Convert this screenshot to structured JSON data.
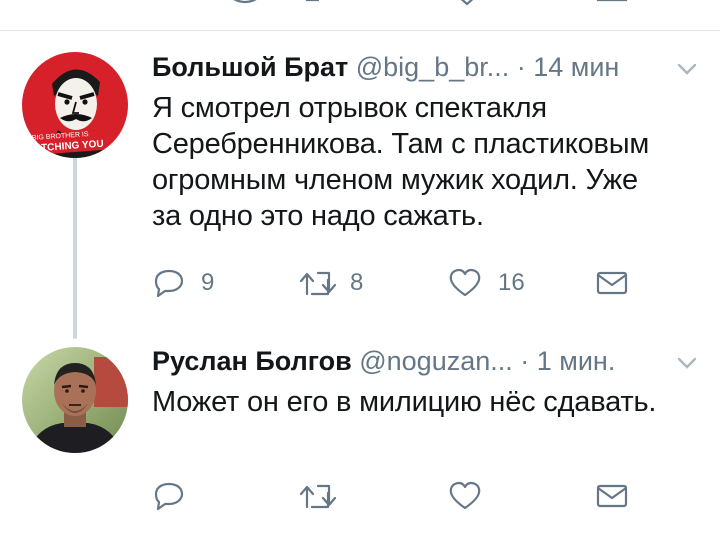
{
  "colors": {
    "text": "#14171a",
    "secondary": "#657786",
    "icon": "#657786",
    "thread_line": "#ccd6dd",
    "divider": "#e1e8ed"
  },
  "tweets": [
    {
      "avatar_icon": "big-brother-poster-avatar",
      "avatar_text": "BIG BROTHER IS WATCHING YOU",
      "name": "Большой Брат",
      "handle": "@big_b_br...",
      "time": "· 14 мин",
      "text_lines": [
        "Я смотрел отрывок спектакля",
        "Серебренникова. Там с пластиковым",
        "огромным членом мужик ходил. Уже",
        "за одно это надо сажать."
      ],
      "replies": "9",
      "retweets": "8",
      "likes": "16"
    },
    {
      "avatar_icon": "person-photo-avatar",
      "name": "Руслан Болгов",
      "handle": "@noguzan...",
      "time": "· 1 мин.",
      "text_lines": [
        "Может он его в милицию нёс сдавать."
      ]
    }
  ]
}
